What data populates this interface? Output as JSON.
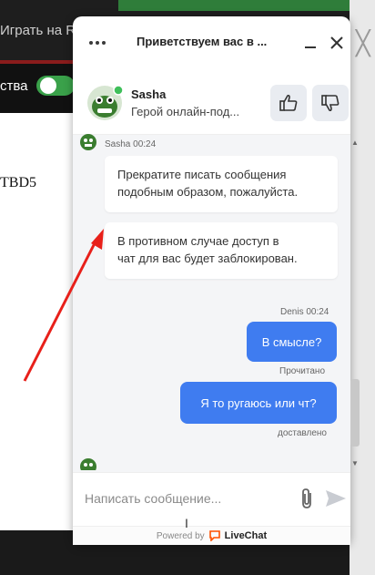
{
  "background": {
    "play_label": "Играть на R",
    "partial_label": "ства",
    "tbd_label": "TBD5",
    "close_glyph": "╳"
  },
  "widget": {
    "title": "Приветствуем вас в ...",
    "agent": {
      "name": "Sasha",
      "subtitle": "Герой онлайн-под..."
    },
    "messages": [
      {
        "author": "Sasha",
        "time": "00:24",
        "meta": "Sasha 00:24",
        "text_lines": [
          "Прекратите писать сообщения",
          "подобным образом, пожалуйста."
        ]
      },
      {
        "author": "Sasha",
        "text_lines": [
          "В противном случае доступ в",
          "чат для вас будет заблокирован."
        ]
      },
      {
        "author": "Denis",
        "time": "00:24",
        "meta": "Denis 00:24",
        "text": "В смысле?",
        "status": "Прочитано"
      },
      {
        "author": "Denis",
        "text": "Я то ругаюсь или чт?",
        "status": "доставлено"
      }
    ],
    "input_placeholder": "Написать сообщение...",
    "powered_by": "Powered by",
    "brand": "LiveChat"
  },
  "icons": [
    "menu-dots-icon",
    "minimize-icon",
    "close-icon",
    "thumb-up-icon",
    "thumb-down-icon",
    "paperclip-icon",
    "send-icon",
    "livechat-logo-icon",
    "agent-avatar-icon"
  ],
  "colors": {
    "accent": "#3f7cf0",
    "online": "#3fbf5a",
    "brand": "#ff5100",
    "annotation": "#e8201a"
  }
}
